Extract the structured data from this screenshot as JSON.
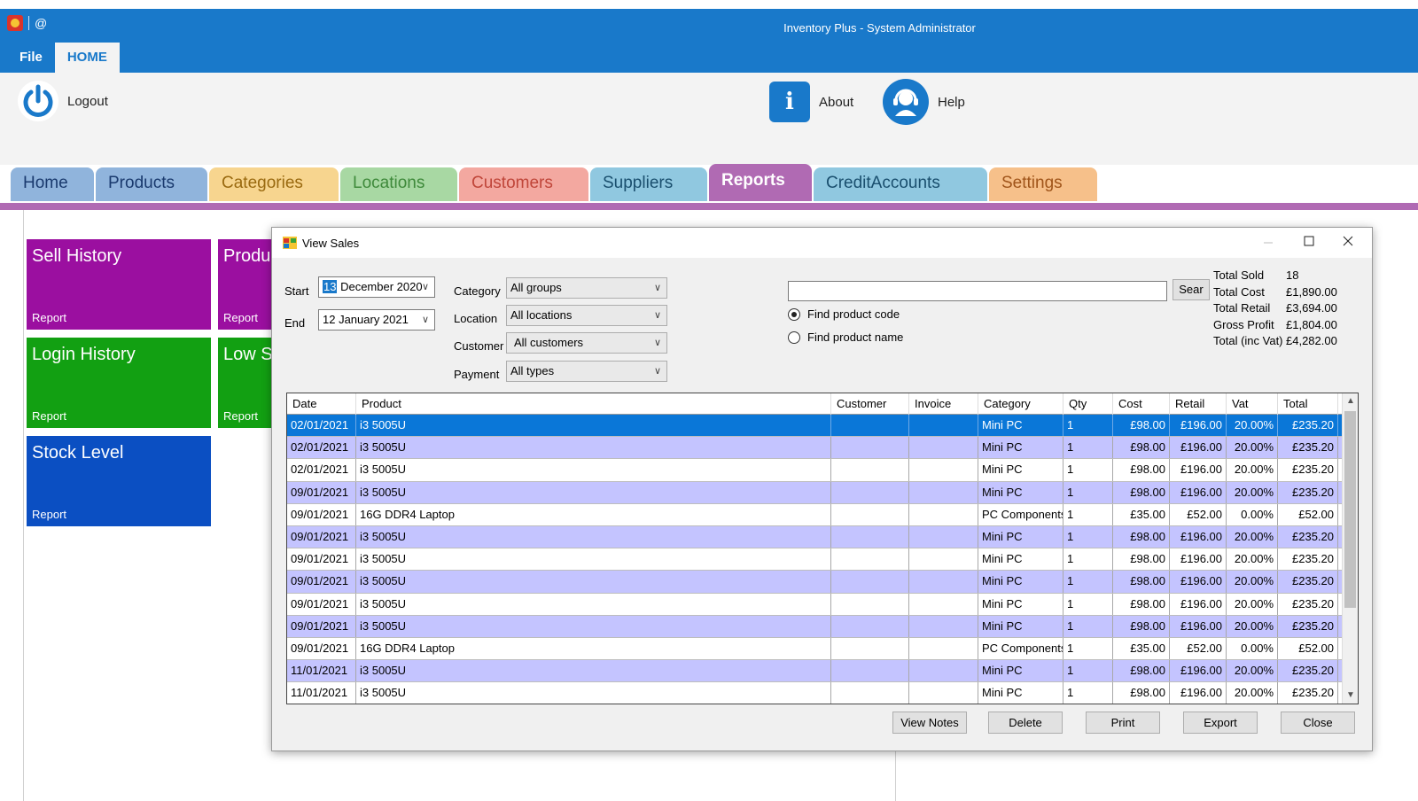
{
  "window": {
    "title": "Inventory Plus - System Administrator",
    "quick_access": "@"
  },
  "ribbon": {
    "tabs": [
      "File",
      "HOME"
    ],
    "logout_label": "Logout",
    "about_label": "About",
    "help_label": "Help"
  },
  "nav": {
    "tabs": [
      {
        "label": "Home",
        "color": "#90b4dc",
        "text": "#1a3a6e"
      },
      {
        "label": "Products",
        "color": "#90b4dc",
        "text": "#1a3a6e"
      },
      {
        "label": "Categories",
        "color": "#f7d58f",
        "text": "#9a6a10"
      },
      {
        "label": "Locations",
        "color": "#a8d8a3",
        "text": "#3f8a3b"
      },
      {
        "label": "Customers",
        "color": "#f3a8a0",
        "text": "#c0463a"
      },
      {
        "label": "Suppliers",
        "color": "#90c8e0",
        "text": "#1a4f6e"
      },
      {
        "label": "Reports",
        "color": "#b06ab3",
        "text": "#ffffff"
      },
      {
        "label": "CreditAccounts",
        "color": "#90c8e0",
        "text": "#1a4f6e"
      },
      {
        "label": "Settings",
        "color": "#f6c08a",
        "text": "#a0551a"
      }
    ],
    "active_index": 6
  },
  "tiles": [
    {
      "title": "Sell History",
      "sub": "Report",
      "color": "#9b0fa0"
    },
    {
      "title": "Produ",
      "sub": "Report",
      "color": "#9b0fa0"
    },
    {
      "title": "Login History",
      "sub": "Report",
      "color": "#12a012"
    },
    {
      "title": "Low S",
      "sub": "Report",
      "color": "#12a012"
    },
    {
      "title": "Stock Level",
      "sub": "Report",
      "color": "#0b4fc2"
    }
  ],
  "dialog": {
    "title": "View Sales",
    "start_label": "Start",
    "start_day": "13",
    "start_rest": " December 2020",
    "end_label": "End",
    "end_value": "12   January   2021",
    "filters": [
      {
        "label": "Category",
        "value": "All groups"
      },
      {
        "label": "Location",
        "value": "All locations"
      },
      {
        "label": "Customer",
        "value": "All customers"
      },
      {
        "label": "Payment",
        "value": "All types"
      }
    ],
    "search_value": "",
    "search_button": "Sear",
    "radio_code": "Find product code",
    "radio_name": "Find product name",
    "totals": [
      {
        "k": "Total Sold",
        "v": "18"
      },
      {
        "k": "Total Cost",
        "v": "£1,890.00"
      },
      {
        "k": "Total Retail",
        "v": "£3,694.00"
      },
      {
        "k": "Gross Profit",
        "v": "£1,804.00"
      },
      {
        "k": "Total (inc Vat)",
        "v": "£4,282.00"
      }
    ],
    "columns": [
      "Date",
      "Product",
      "Customer",
      "Invoice",
      "Category",
      "Qty",
      "Cost",
      "Retail",
      "Vat",
      "Total"
    ],
    "rows": [
      [
        "02/01/2021",
        "i3 5005U",
        "",
        "",
        "Mini PC",
        "1",
        "£98.00",
        "£196.00",
        "20.00%",
        "£235.20"
      ],
      [
        "02/01/2021",
        "i3 5005U",
        "",
        "",
        "Mini PC",
        "1",
        "£98.00",
        "£196.00",
        "20.00%",
        "£235.20"
      ],
      [
        "02/01/2021",
        "i3 5005U",
        "",
        "",
        "Mini PC",
        "1",
        "£98.00",
        "£196.00",
        "20.00%",
        "£235.20"
      ],
      [
        "09/01/2021",
        "i3 5005U",
        "",
        "",
        "Mini PC",
        "1",
        "£98.00",
        "£196.00",
        "20.00%",
        "£235.20"
      ],
      [
        "09/01/2021",
        "16G DDR4 Laptop",
        "",
        "",
        "PC Components",
        "1",
        "£35.00",
        "£52.00",
        "0.00%",
        "£52.00"
      ],
      [
        "09/01/2021",
        "i3 5005U",
        "",
        "",
        "Mini PC",
        "1",
        "£98.00",
        "£196.00",
        "20.00%",
        "£235.20"
      ],
      [
        "09/01/2021",
        "i3 5005U",
        "",
        "",
        "Mini PC",
        "1",
        "£98.00",
        "£196.00",
        "20.00%",
        "£235.20"
      ],
      [
        "09/01/2021",
        "i3 5005U",
        "",
        "",
        "Mini PC",
        "1",
        "£98.00",
        "£196.00",
        "20.00%",
        "£235.20"
      ],
      [
        "09/01/2021",
        "i3 5005U",
        "",
        "",
        "Mini PC",
        "1",
        "£98.00",
        "£196.00",
        "20.00%",
        "£235.20"
      ],
      [
        "09/01/2021",
        "i3 5005U",
        "",
        "",
        "Mini PC",
        "1",
        "£98.00",
        "£196.00",
        "20.00%",
        "£235.20"
      ],
      [
        "09/01/2021",
        "16G DDR4 Laptop",
        "",
        "",
        "PC Components",
        "1",
        "£35.00",
        "£52.00",
        "0.00%",
        "£52.00"
      ],
      [
        "11/01/2021",
        "i3 5005U",
        "",
        "",
        "Mini PC",
        "1",
        "£98.00",
        "£196.00",
        "20.00%",
        "£235.20"
      ],
      [
        "11/01/2021",
        "i3 5005U",
        "",
        "",
        "Mini PC",
        "1",
        "£98.00",
        "£196.00",
        "20.00%",
        "£235.20"
      ]
    ],
    "selected_row": 0,
    "buttons": [
      "View Notes",
      "Delete",
      "Print",
      "Export",
      "Close"
    ]
  }
}
